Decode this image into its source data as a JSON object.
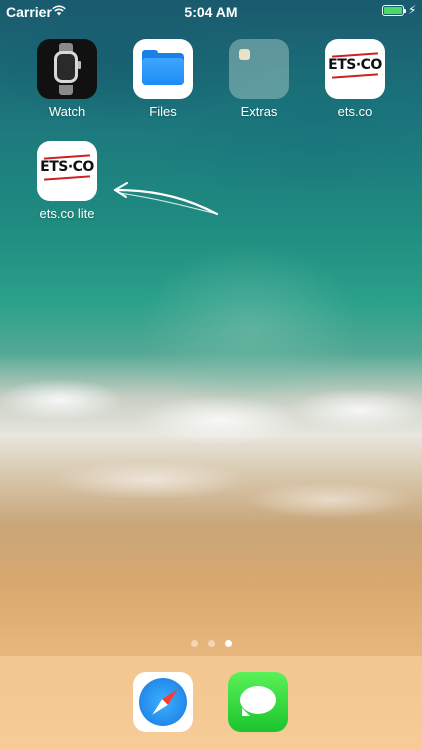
{
  "status_bar": {
    "carrier": "Carrier",
    "time": "5:04 AM",
    "wifi_icon": "wifi-icon",
    "battery_icon": "battery-icon",
    "charging_icon": "charging-bolt-icon",
    "battery_color": "#4cd964"
  },
  "home_screen": {
    "apps": [
      {
        "label": "Watch",
        "icon": "apple-watch-icon"
      },
      {
        "label": "Files",
        "icon": "folder-icon"
      },
      {
        "label": "Extras",
        "icon": "folder-group-icon"
      },
      {
        "label": "ets.co",
        "icon": "ets-co-logo-icon",
        "logo_text": "ETS·CO"
      },
      {
        "label": "ets.co lite",
        "icon": "ets-co-logo-icon",
        "logo_text": "ETS·CO"
      }
    ],
    "annotation": "hand-drawn-arrow-icon",
    "page_dots": {
      "count": 3,
      "active_index": 2
    }
  },
  "dock": {
    "apps": [
      {
        "name": "Safari",
        "icon": "safari-compass-icon"
      },
      {
        "name": "Messages",
        "icon": "messages-bubble-icon"
      }
    ]
  }
}
